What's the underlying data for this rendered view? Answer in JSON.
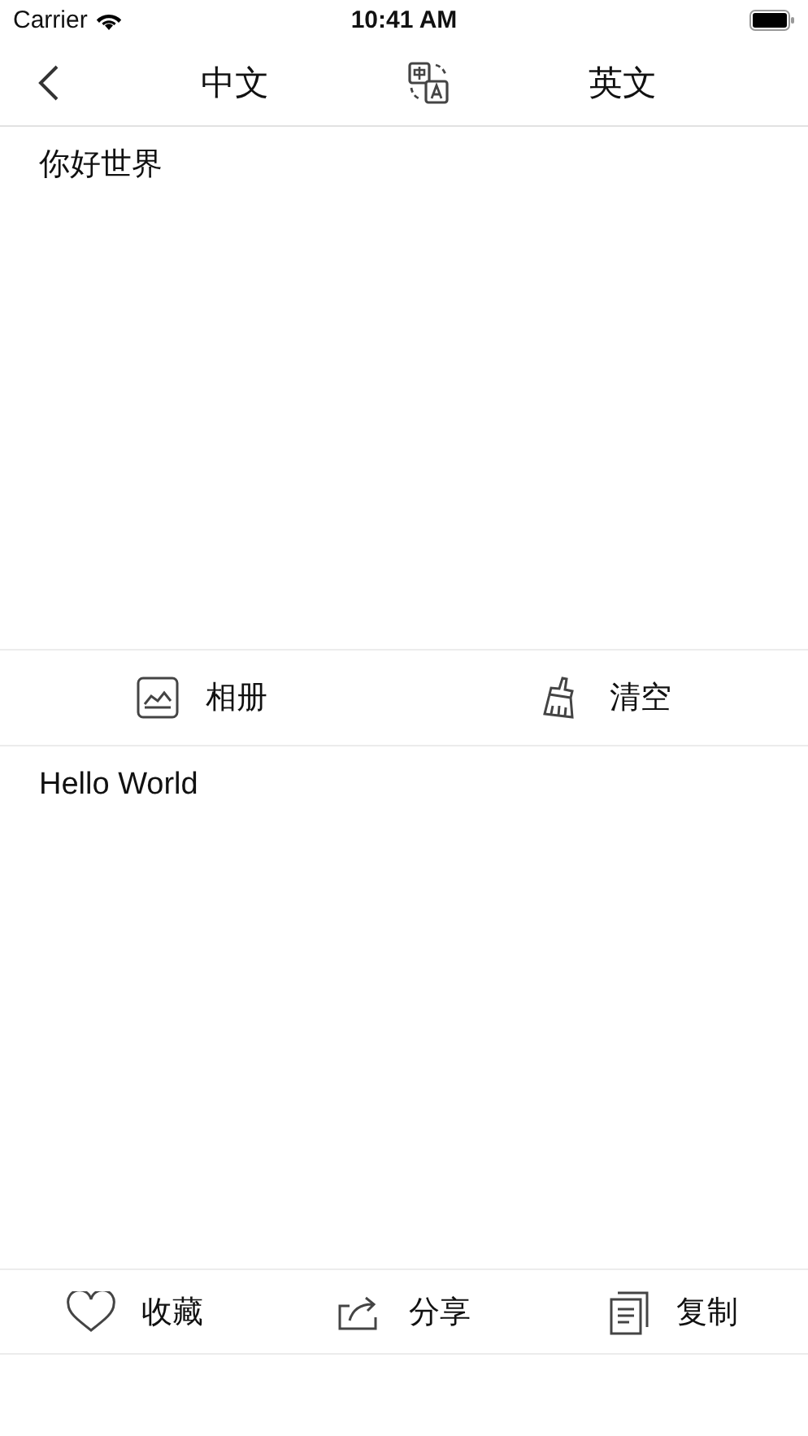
{
  "status_bar": {
    "carrier": "Carrier",
    "time": "10:41 AM"
  },
  "nav": {
    "source_language": "中文",
    "target_language": "英文"
  },
  "input": {
    "value": "你好世界"
  },
  "input_actions": [
    {
      "kind": "album",
      "label": "相册"
    },
    {
      "kind": "clear",
      "label": "清空"
    }
  ],
  "output": {
    "text": "Hello World"
  },
  "output_actions": [
    {
      "kind": "favorite",
      "label": "收藏"
    },
    {
      "kind": "share",
      "label": "分享"
    },
    {
      "kind": "copy",
      "label": "复制"
    }
  ]
}
